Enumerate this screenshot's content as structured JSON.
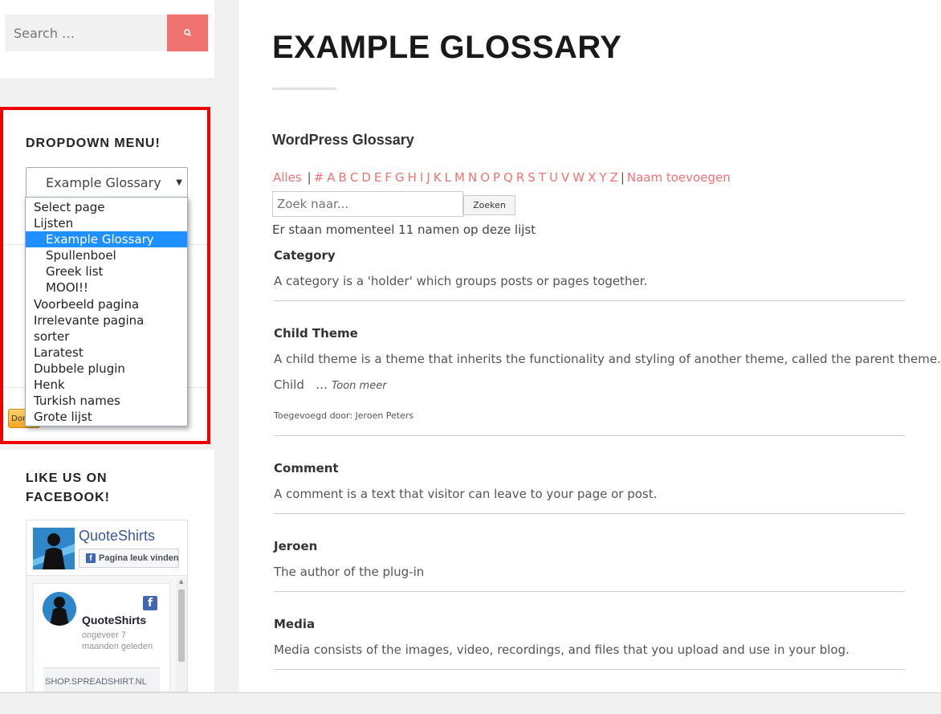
{
  "search": {
    "placeholder": "Search …"
  },
  "dropdown_widget": {
    "title": "DROPDOWN MENU!",
    "selected_value": "Example Glossary",
    "donate_label": "Donate",
    "options": [
      {
        "label": "Select page",
        "indent": false,
        "selected": false
      },
      {
        "label": "Lijsten",
        "indent": false,
        "selected": false
      },
      {
        "label": "Example Glossary",
        "indent": true,
        "selected": true
      },
      {
        "label": "Spullenboel",
        "indent": true,
        "selected": false
      },
      {
        "label": "Greek list",
        "indent": true,
        "selected": false
      },
      {
        "label": "MOOI!!",
        "indent": true,
        "selected": false
      },
      {
        "label": "Voorbeeld pagina",
        "indent": false,
        "selected": false
      },
      {
        "label": "Irrelevante pagina",
        "indent": false,
        "selected": false
      },
      {
        "label": "sorter",
        "indent": false,
        "selected": false
      },
      {
        "label": "Laratest",
        "indent": false,
        "selected": false
      },
      {
        "label": "Dubbele plugin",
        "indent": false,
        "selected": false
      },
      {
        "label": "Henk",
        "indent": false,
        "selected": false
      },
      {
        "label": "Turkish names",
        "indent": false,
        "selected": false
      },
      {
        "label": "Grote lijst",
        "indent": false,
        "selected": false
      }
    ]
  },
  "facebook": {
    "title": "LIKE US ON FACEBOOK!",
    "page_name": "QuoteShirts",
    "like_label": "Pagina leuk vinden",
    "post": {
      "author": "QuoteShirts",
      "time": "ongeveer 7 maanden geleden",
      "link_text": "SHOP.SPREADSHIRT.NL"
    }
  },
  "main": {
    "title": "EXAMPLE GLOSSARY",
    "glossary_title": "WordPress Glossary",
    "nav": {
      "all": "Alles",
      "letters": [
        "#",
        "A",
        "B",
        "C",
        "D",
        "E",
        "F",
        "G",
        "H",
        "I",
        "J",
        "K",
        "L",
        "M",
        "N",
        "O",
        "P",
        "Q",
        "R",
        "S",
        "T",
        "U",
        "V",
        "W",
        "X",
        "Y",
        "Z"
      ],
      "add": "Naam toevoegen"
    },
    "search_placeholder": "Zoek naar...",
    "search_button": "Zoeken",
    "count_text": "Er staan momenteel 11 namen op deze lijst",
    "entries": [
      {
        "term": "Category",
        "definition": "A category is a 'holder' which groups posts or pages together."
      },
      {
        "term": "Child Theme",
        "definition": "A child theme is a theme that inherits the functionality and styling of another theme, called the parent theme.",
        "definition_cont": "Child",
        "more": "Toon meer",
        "meta": "Toegevoegd door: Jeroen Peters"
      },
      {
        "term": "Comment",
        "definition": "A comment is a text that visitor can leave to your page or post."
      },
      {
        "term": "Jeroen",
        "definition": "The author of the plug-in"
      },
      {
        "term": "Media",
        "definition": "Media consists of the images, video, recordings, and files that you upload and use in your blog."
      }
    ]
  },
  "colors": {
    "accent": "#f07372",
    "highlight_border": "#ee0000",
    "option_selected": "#1e90ff",
    "facebook_blue": "#4267b2"
  }
}
